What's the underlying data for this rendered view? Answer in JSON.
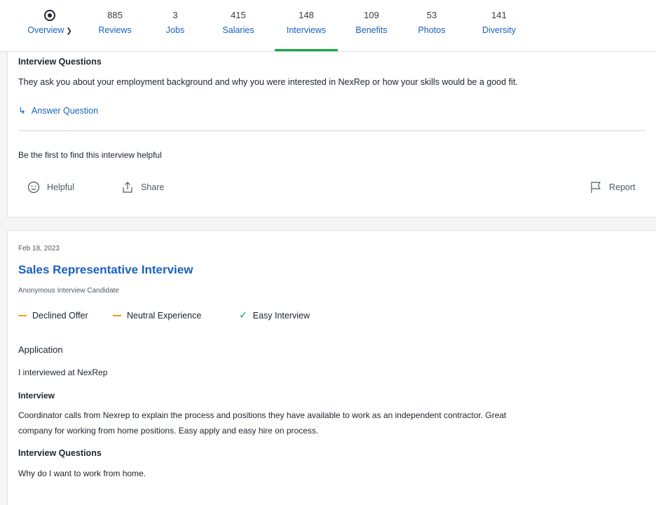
{
  "nav": {
    "overview_label": "Overview",
    "items": [
      {
        "count": "885",
        "label": "Reviews"
      },
      {
        "count": "3",
        "label": "Jobs"
      },
      {
        "count": "415",
        "label": "Salaries"
      },
      {
        "count": "148",
        "label": "Interviews"
      },
      {
        "count": "109",
        "label": "Benefits"
      },
      {
        "count": "53",
        "label": "Photos"
      },
      {
        "count": "141",
        "label": "Diversity"
      }
    ],
    "active": "Interviews"
  },
  "card1": {
    "questions_heading": "Interview Questions",
    "question_text": "They ask you about your employment background and why you were interested in NexRep or how your skills would be a good fit.",
    "answer_link": "Answer Question",
    "helpful_prompt": "Be the first to find this interview helpful",
    "helpful_label": "Helpful",
    "share_label": "Share",
    "report_label": "Report"
  },
  "card2": {
    "date": "Feb 18, 2023",
    "title": "Sales Representative Interview",
    "author": "Anonymous Interview Candidate",
    "badges": [
      {
        "type": "neutral",
        "label": "Declined Offer"
      },
      {
        "type": "neutral",
        "label": "Neutral Experience"
      },
      {
        "type": "positive",
        "label": "Easy Interview"
      }
    ],
    "application_heading": "Application",
    "application_text": "I interviewed at NexRep",
    "interview_heading": "Interview",
    "interview_text_line1": "Coordinator calls from Nexrep to explain the process and positions they have available to work as an independent contractor. Great",
    "interview_text_line2": "company for working from home positions. Easy apply and easy hire on process.",
    "questions_heading": "Interview Questions",
    "question_text": "Why do I want to work from home."
  },
  "colors": {
    "link": "#1861bf",
    "active_underline": "#0caa41",
    "neutral_dash": "#e8a317",
    "positive_check": "#0caa41"
  }
}
